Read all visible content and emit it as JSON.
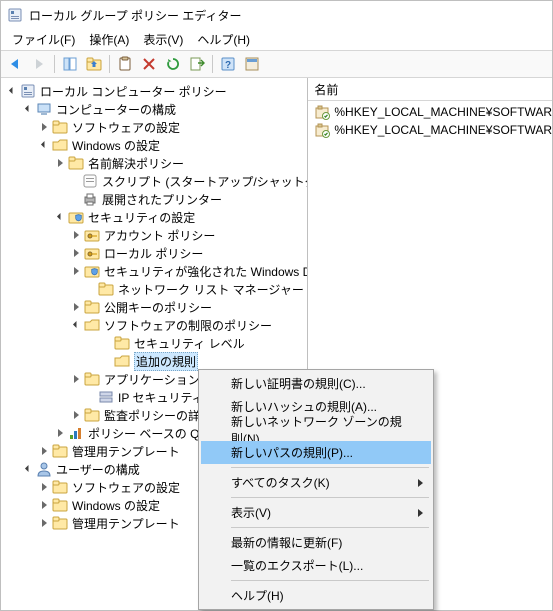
{
  "title": "ローカル グループ ポリシー エディター",
  "menubar": {
    "file": "ファイル(F)",
    "action": "操作(A)",
    "view": "表示(V)",
    "help": "ヘルプ(H)"
  },
  "list": {
    "header_name": "名前",
    "rows": [
      "%HKEY_LOCAL_MACHINE¥SOFTWAR",
      "%HKEY_LOCAL_MACHINE¥SOFTWAR"
    ]
  },
  "tree": {
    "root": "ローカル コンピューター ポリシー",
    "computer_config": "コンピューターの構成",
    "software_settings": "ソフトウェアの設定",
    "windows_settings": "Windows の設定",
    "name_resolution": "名前解決ポリシー",
    "scripts": "スクリプト (スタートアップ/シャットダウン)",
    "deployed_printers": "展開されたプリンター",
    "security_settings": "セキュリティの設定",
    "account_policy": "アカウント ポリシー",
    "local_policy": "ローカル ポリシー",
    "defender": "セキュリティが強化された Windows Defender フ",
    "network_list": "ネットワーク リスト マネージャー ポリシー",
    "public_key": "公開キーのポリシー",
    "software_restriction": "ソフトウェアの制限のポリシー",
    "security_level": "セキュリティ レベル",
    "additional_rules": "追加の規則",
    "app_control": "アプリケーション制",
    "ip_security": "IP セキュリティ ポ",
    "audit_policy": "監査ポリシーの詳",
    "policy_qos": "ポリシー ベースの Qo",
    "admin_templates_c": "管理用テンプレート",
    "user_config": "ユーザーの構成",
    "software_settings_u": "ソフトウェアの設定",
    "windows_settings_u": "Windows の設定",
    "admin_templates_u": "管理用テンプレート"
  },
  "context_menu": {
    "new_cert_rule": "新しい証明書の規則(C)...",
    "new_hash_rule": "新しいハッシュの規則(A)...",
    "new_zone_rule": "新しいネットワーク ゾーンの規則(N)...",
    "new_path_rule": "新しいパスの規則(P)...",
    "all_tasks": "すべてのタスク(K)",
    "view": "表示(V)",
    "refresh": "最新の情報に更新(F)",
    "export_list": "一覧のエクスポート(L)...",
    "help": "ヘルプ(H)"
  }
}
